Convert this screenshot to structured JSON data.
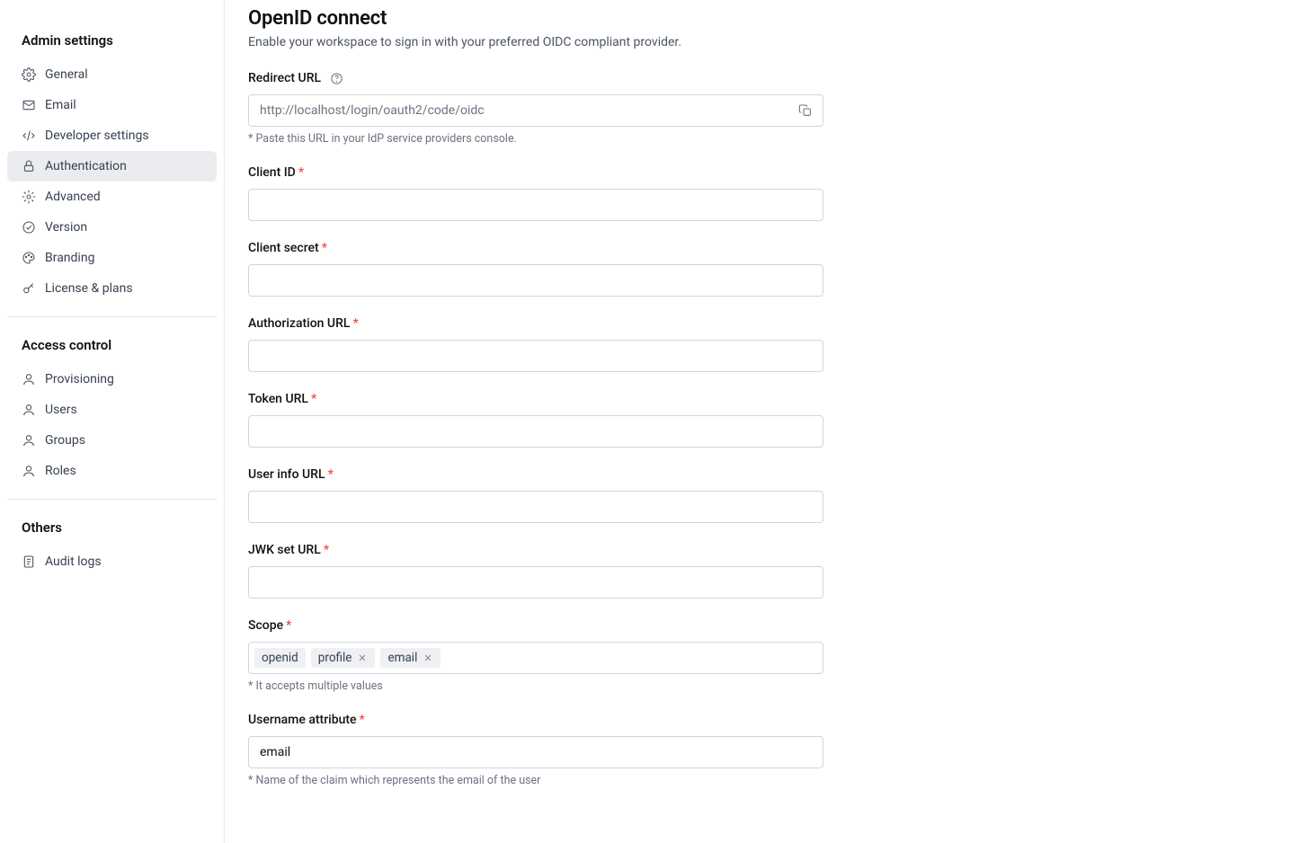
{
  "sidebar": {
    "sections": [
      {
        "title": "Admin settings",
        "items": [
          {
            "label": "General",
            "icon": "settings-icon",
            "name": "sidebar-item-general"
          },
          {
            "label": "Email",
            "icon": "mail-icon",
            "name": "sidebar-item-email"
          },
          {
            "label": "Developer settings",
            "icon": "code-icon",
            "name": "sidebar-item-developer"
          },
          {
            "label": "Authentication",
            "icon": "lock-icon",
            "name": "sidebar-item-authentication",
            "active": true
          },
          {
            "label": "Advanced",
            "icon": "gear-icon",
            "name": "sidebar-item-advanced"
          },
          {
            "label": "Version",
            "icon": "check-circle-icon",
            "name": "sidebar-item-version"
          },
          {
            "label": "Branding",
            "icon": "palette-icon",
            "name": "sidebar-item-branding"
          },
          {
            "label": "License & plans",
            "icon": "key-icon",
            "name": "sidebar-item-license"
          }
        ]
      },
      {
        "title": "Access control",
        "items": [
          {
            "label": "Provisioning",
            "icon": "user-icon",
            "name": "sidebar-item-provisioning"
          },
          {
            "label": "Users",
            "icon": "user-icon",
            "name": "sidebar-item-users"
          },
          {
            "label": "Groups",
            "icon": "user-icon",
            "name": "sidebar-item-groups"
          },
          {
            "label": "Roles",
            "icon": "user-icon",
            "name": "sidebar-item-roles"
          }
        ]
      },
      {
        "title": "Others",
        "items": [
          {
            "label": "Audit logs",
            "icon": "document-icon",
            "name": "sidebar-item-audit-logs"
          }
        ]
      }
    ]
  },
  "page": {
    "title": "OpenID connect",
    "subtitle": "Enable your workspace to sign in with your preferred OIDC compliant provider."
  },
  "form": {
    "redirect_url": {
      "label": "Redirect URL",
      "value": "http://localhost/login/oauth2/code/oidc",
      "hint": "* Paste this URL in your IdP service providers console."
    },
    "client_id": {
      "label": "Client ID",
      "value": ""
    },
    "client_secret": {
      "label": "Client secret",
      "value": ""
    },
    "authorization_url": {
      "label": "Authorization URL",
      "value": ""
    },
    "token_url": {
      "label": "Token URL",
      "value": ""
    },
    "user_info_url": {
      "label": "User info URL",
      "value": ""
    },
    "jwk_set_url": {
      "label": "JWK set URL",
      "value": ""
    },
    "scope": {
      "label": "Scope",
      "tags": [
        "openid",
        "profile",
        "email"
      ],
      "hint": "* It accepts multiple values"
    },
    "username_attribute": {
      "label": "Username attribute",
      "value": "email",
      "hint": "* Name of the claim which represents the email of the user"
    }
  }
}
